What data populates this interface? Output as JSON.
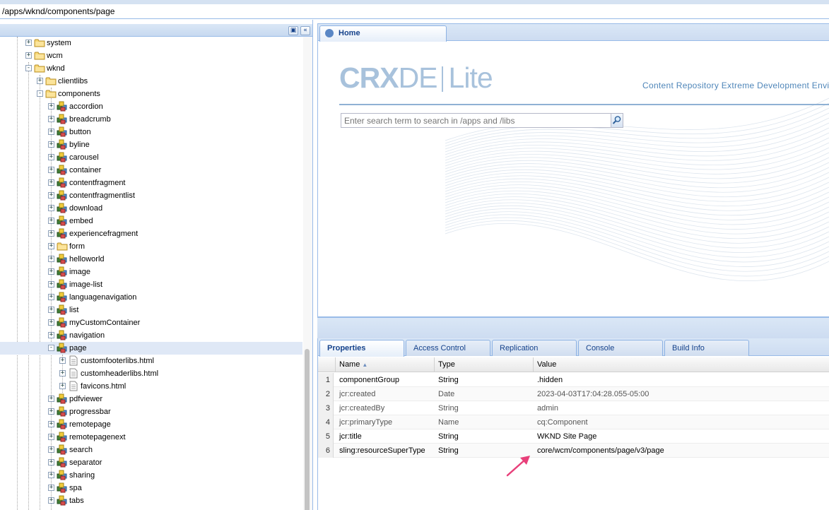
{
  "path": "/apps/wknd/components/page",
  "tree": {
    "items": [
      {
        "label": "system",
        "depth": 2,
        "expander": "+",
        "icon": "folder-icon"
      },
      {
        "label": "wcm",
        "depth": 2,
        "expander": "+",
        "icon": "folder-icon"
      },
      {
        "label": "wknd",
        "depth": 2,
        "expander": "-",
        "icon": "folder-icon"
      },
      {
        "label": "clientlibs",
        "depth": 3,
        "expander": "+",
        "icon": "folder-icon"
      },
      {
        "label": "components",
        "depth": 3,
        "expander": "-",
        "icon": "folder-icon"
      },
      {
        "label": "accordion",
        "depth": 4,
        "expander": "+",
        "icon": "component-icon"
      },
      {
        "label": "breadcrumb",
        "depth": 4,
        "expander": "+",
        "icon": "component-icon"
      },
      {
        "label": "button",
        "depth": 4,
        "expander": "+",
        "icon": "component-icon"
      },
      {
        "label": "byline",
        "depth": 4,
        "expander": "+",
        "icon": "component-icon"
      },
      {
        "label": "carousel",
        "depth": 4,
        "expander": "+",
        "icon": "component-icon"
      },
      {
        "label": "container",
        "depth": 4,
        "expander": "+",
        "icon": "component-icon"
      },
      {
        "label": "contentfragment",
        "depth": 4,
        "expander": "+",
        "icon": "component-icon"
      },
      {
        "label": "contentfragmentlist",
        "depth": 4,
        "expander": "+",
        "icon": "component-icon"
      },
      {
        "label": "download",
        "depth": 4,
        "expander": "+",
        "icon": "component-icon"
      },
      {
        "label": "embed",
        "depth": 4,
        "expander": "+",
        "icon": "component-icon"
      },
      {
        "label": "experiencefragment",
        "depth": 4,
        "expander": "+",
        "icon": "component-icon"
      },
      {
        "label": "form",
        "depth": 4,
        "expander": "+",
        "icon": "folder-icon"
      },
      {
        "label": "helloworld",
        "depth": 4,
        "expander": "+",
        "icon": "component-icon"
      },
      {
        "label": "image",
        "depth": 4,
        "expander": "+",
        "icon": "component-icon"
      },
      {
        "label": "image-list",
        "depth": 4,
        "expander": "+",
        "icon": "component-icon"
      },
      {
        "label": "languagenavigation",
        "depth": 4,
        "expander": "+",
        "icon": "component-icon"
      },
      {
        "label": "list",
        "depth": 4,
        "expander": "+",
        "icon": "component-icon"
      },
      {
        "label": "myCustomContainer",
        "depth": 4,
        "expander": "+",
        "icon": "component-icon"
      },
      {
        "label": "navigation",
        "depth": 4,
        "expander": "+",
        "icon": "component-icon"
      },
      {
        "label": "page",
        "depth": 4,
        "expander": "-",
        "icon": "component-icon",
        "selected": true
      },
      {
        "label": "customfooterlibs.html",
        "depth": 5,
        "expander": "+",
        "icon": "file-icon"
      },
      {
        "label": "customheaderlibs.html",
        "depth": 5,
        "expander": "+",
        "icon": "file-icon"
      },
      {
        "label": "favicons.html",
        "depth": 5,
        "expander": "+",
        "icon": "file-icon"
      },
      {
        "label": "pdfviewer",
        "depth": 4,
        "expander": "+",
        "icon": "component-icon"
      },
      {
        "label": "progressbar",
        "depth": 4,
        "expander": "+",
        "icon": "component-icon"
      },
      {
        "label": "remotepage",
        "depth": 4,
        "expander": "+",
        "icon": "component-icon"
      },
      {
        "label": "remotepagenext",
        "depth": 4,
        "expander": "+",
        "icon": "component-icon"
      },
      {
        "label": "search",
        "depth": 4,
        "expander": "+",
        "icon": "component-icon"
      },
      {
        "label": "separator",
        "depth": 4,
        "expander": "+",
        "icon": "component-icon"
      },
      {
        "label": "sharing",
        "depth": 4,
        "expander": "+",
        "icon": "component-icon"
      },
      {
        "label": "spa",
        "depth": 4,
        "expander": "+",
        "icon": "component-icon"
      },
      {
        "label": "tabs",
        "depth": 4,
        "expander": "+",
        "icon": "component-icon"
      }
    ]
  },
  "home": {
    "tab_label": "Home",
    "logo_bold": "CRX",
    "logo_thin": "DE",
    "logo_lite": "Lite",
    "tagline": "Content Repository Extreme Development Environment",
    "search_placeholder": "Enter search term to search in /apps and /libs"
  },
  "bottom_tabs": [
    "Properties",
    "Access Control",
    "Replication",
    "Console",
    "Build Info"
  ],
  "properties": {
    "columns": [
      "Name",
      "Type",
      "Value"
    ],
    "sort_indicator": "▲",
    "rows": [
      {
        "n": "1",
        "name": "componentGroup",
        "type": "String",
        "value": ".hidden",
        "protected": false
      },
      {
        "n": "2",
        "name": "jcr:created",
        "type": "Date",
        "value": "2023-04-03T17:04:28.055-05:00",
        "protected": true
      },
      {
        "n": "3",
        "name": "jcr:createdBy",
        "type": "String",
        "value": "admin",
        "protected": true
      },
      {
        "n": "4",
        "name": "jcr:primaryType",
        "type": "Name",
        "value": "cq:Component",
        "protected": true
      },
      {
        "n": "5",
        "name": "jcr:title",
        "type": "String",
        "value": "WKND Site Page",
        "protected": false
      },
      {
        "n": "6",
        "name": "sling:resourceSuperType",
        "type": "String",
        "value": "core/wcm/components/page/v3/page",
        "protected": false
      }
    ]
  },
  "colors": {
    "accent": "#15428b",
    "panel_border": "#99bbe8",
    "selection": "#dfe8f6",
    "annotation_arrow": "#e8407a"
  }
}
